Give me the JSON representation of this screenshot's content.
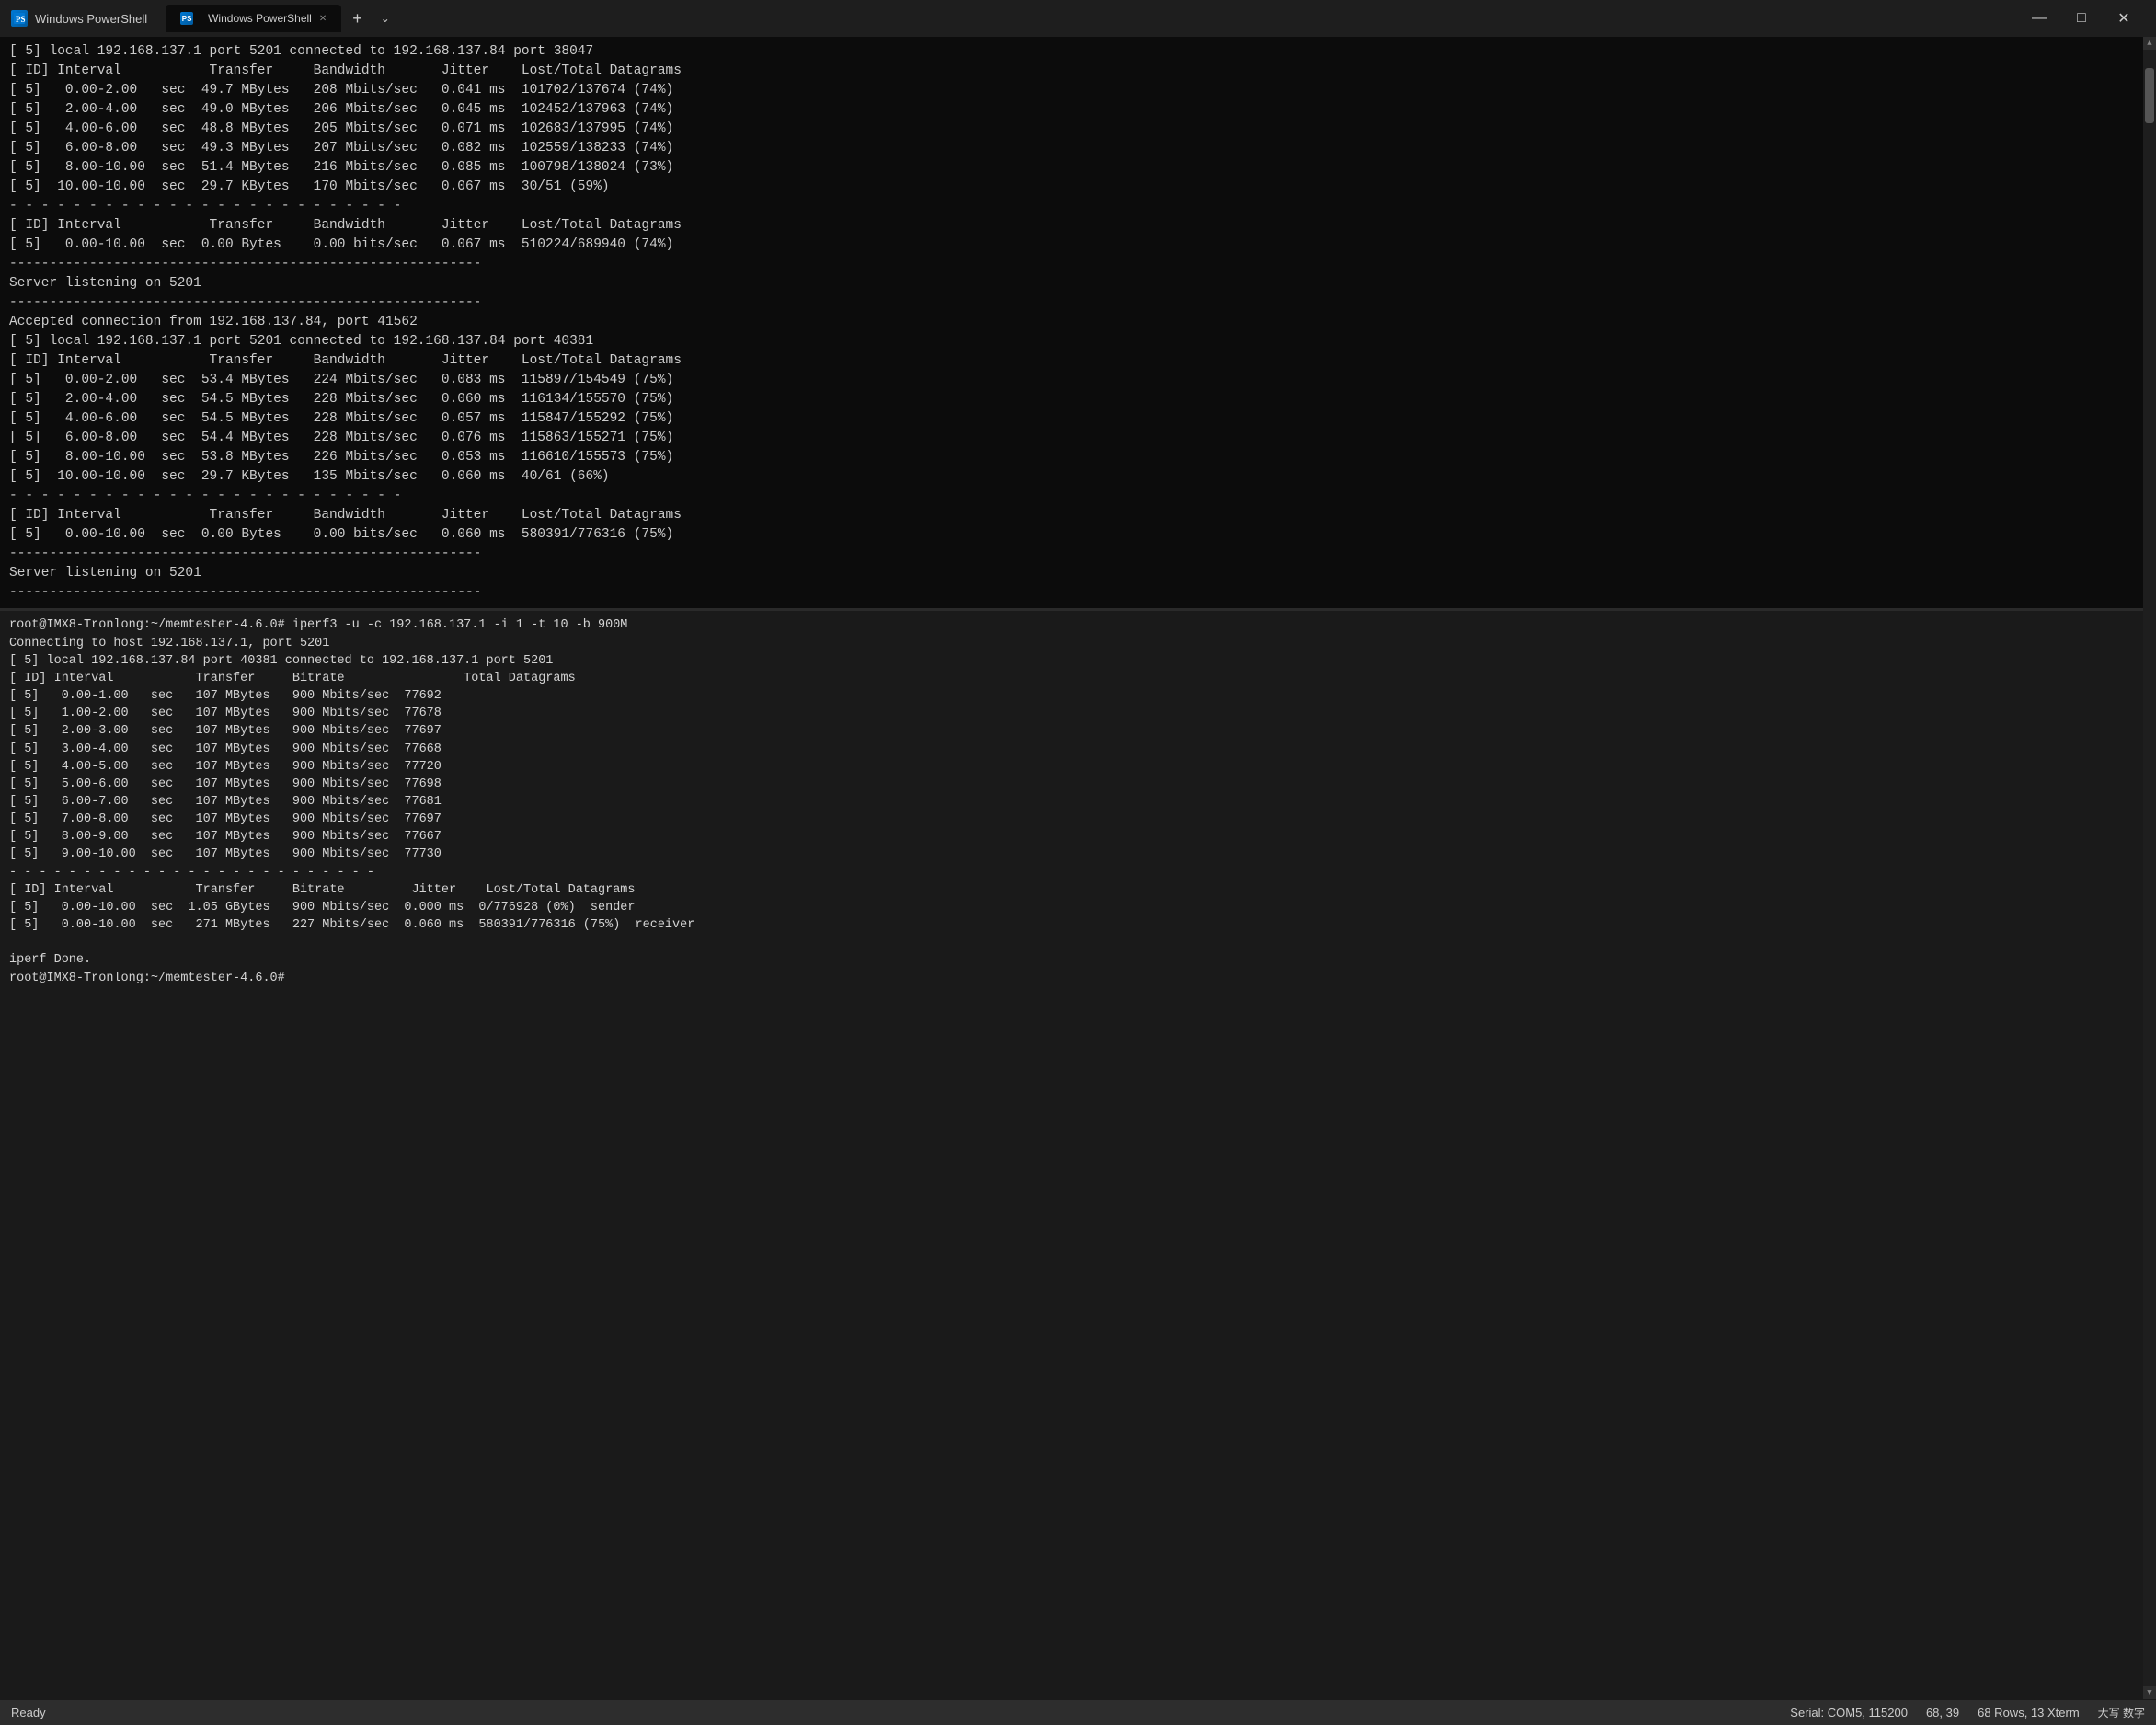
{
  "titlebar": {
    "icon_label": "PS",
    "title": "Windows PowerShell",
    "tabs": [
      {
        "label": "Windows PowerShell",
        "active": true
      }
    ],
    "new_tab_label": "+",
    "dropdown_label": "⌄",
    "minimize": "—",
    "maximize": "□",
    "close": "✕"
  },
  "ps_top_content": "[ 5] local 192.168.137.1 port 5201 connected to 192.168.137.84 port 38047\n[ ID] Interval           Transfer     Bandwidth       Jitter    Lost/Total Datagrams\n[ 5]   0.00-2.00   sec  49.7 MBytes   208 Mbits/sec   0.041 ms  101702/137674 (74%)\n[ 5]   2.00-4.00   sec  49.0 MBytes   206 Mbits/sec   0.045 ms  102452/137963 (74%)\n[ 5]   4.00-6.00   sec  48.8 MBytes   205 Mbits/sec   0.071 ms  102683/137995 (74%)\n[ 5]   6.00-8.00   sec  49.3 MBytes   207 Mbits/sec   0.082 ms  102559/138233 (74%)\n[ 5]   8.00-10.00  sec  51.4 MBytes   216 Mbits/sec   0.085 ms  100798/138024 (73%)\n[ 5]  10.00-10.00  sec  29.7 KBytes   170 Mbits/sec   0.067 ms  30/51 (59%)\n- - - - - - - - - - - - - - - - - - - - - - - - -\n[ ID] Interval           Transfer     Bandwidth       Jitter    Lost/Total Datagrams\n[ 5]   0.00-10.00  sec  0.00 Bytes    0.00 bits/sec   0.067 ms  510224/689940 (74%)\n-----------------------------------------------------------\nServer listening on 5201\n-----------------------------------------------------------\nAccepted connection from 192.168.137.84, port 41562\n[ 5] local 192.168.137.1 port 5201 connected to 192.168.137.84 port 40381\n[ ID] Interval           Transfer     Bandwidth       Jitter    Lost/Total Datagrams\n[ 5]   0.00-2.00   sec  53.4 MBytes   224 Mbits/sec   0.083 ms  115897/154549 (75%)\n[ 5]   2.00-4.00   sec  54.5 MBytes   228 Mbits/sec   0.060 ms  116134/155570 (75%)\n[ 5]   4.00-6.00   sec  54.5 MBytes   228 Mbits/sec   0.057 ms  115847/155292 (75%)\n[ 5]   6.00-8.00   sec  54.4 MBytes   228 Mbits/sec   0.076 ms  115863/155271 (75%)\n[ 5]   8.00-10.00  sec  53.8 MBytes   226 Mbits/sec   0.053 ms  116610/155573 (75%)\n[ 5]  10.00-10.00  sec  29.7 KBytes   135 Mbits/sec   0.060 ms  40/61 (66%)\n- - - - - - - - - - - - - - - - - - - - - - - - -\n[ ID] Interval           Transfer     Bandwidth       Jitter    Lost/Total Datagrams\n[ 5]   0.00-10.00  sec  0.00 Bytes    0.00 bits/sec   0.060 ms  580391/776316 (75%)\n-----------------------------------------------------------\nServer listening on 5201\n-----------------------------------------------------------",
  "linux_content": "root@IMX8-Tronlong:~/memtester-4.6.0# iperf3 -u -c 192.168.137.1 -i 1 -t 10 -b 900M\nConnecting to host 192.168.137.1, port 5201\n[ 5] local 192.168.137.84 port 40381 connected to 192.168.137.1 port 5201\n[ ID] Interval           Transfer     Bitrate                Total Datagrams\n[ 5]   0.00-1.00   sec   107 MBytes   900 Mbits/sec  77692\n[ 5]   1.00-2.00   sec   107 MBytes   900 Mbits/sec  77678\n[ 5]   2.00-3.00   sec   107 MBytes   900 Mbits/sec  77697\n[ 5]   3.00-4.00   sec   107 MBytes   900 Mbits/sec  77668\n[ 5]   4.00-5.00   sec   107 MBytes   900 Mbits/sec  77720\n[ 5]   5.00-6.00   sec   107 MBytes   900 Mbits/sec  77698\n[ 5]   6.00-7.00   sec   107 MBytes   900 Mbits/sec  77681\n[ 5]   7.00-8.00   sec   107 MBytes   900 Mbits/sec  77697\n[ 5]   8.00-9.00   sec   107 MBytes   900 Mbits/sec  77667\n[ 5]   9.00-10.00  sec   107 MBytes   900 Mbits/sec  77730\n- - - - - - - - - - - - - - - - - - - - - - - - -\n[ ID] Interval           Transfer     Bitrate         Jitter    Lost/Total Datagrams\n[ 5]   0.00-10.00  sec  1.05 GBytes   900 Mbits/sec  0.000 ms  0/776928 (0%)  sender\n[ 5]   0.00-10.00  sec   271 MBytes   227 Mbits/sec  0.060 ms  580391/776316 (75%)  receiver\n\niperf Done.\nroot@IMX8-Tronlong:~/memtester-4.6.0#",
  "statusbar": {
    "ready": "Ready",
    "serial": "Serial: COM5, 115200",
    "position": "68, 39",
    "rows_cols": "68 Rows, 13 Xterm",
    "cjk_label": "大写 数字"
  }
}
